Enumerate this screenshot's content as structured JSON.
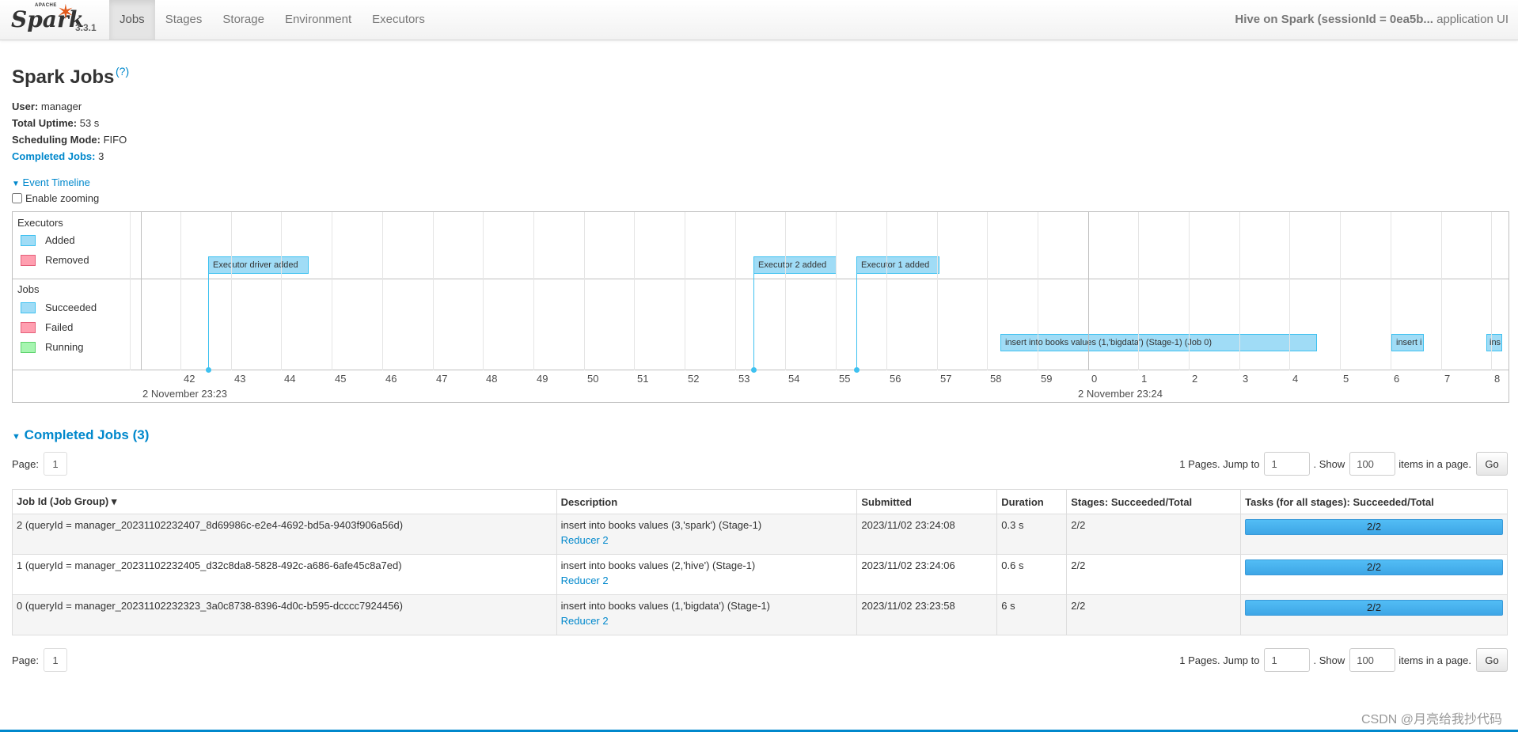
{
  "navbar": {
    "brand_apache": "APACHE",
    "brand_spark": "Spark",
    "version": "3.3.1",
    "tabs": [
      {
        "label": "Jobs",
        "active": true
      },
      {
        "label": "Stages",
        "active": false
      },
      {
        "label": "Storage",
        "active": false
      },
      {
        "label": "Environment",
        "active": false
      },
      {
        "label": "Executors",
        "active": false
      }
    ],
    "app_name_bold": "Hive on Spark (sessionId = 0ea5b...",
    "app_name_suffix": " application UI"
  },
  "page": {
    "title": "Spark Jobs",
    "help": "(?)"
  },
  "summary": {
    "user_label": "User:",
    "user": "manager",
    "uptime_label": "Total Uptime:",
    "uptime": "53 s",
    "mode_label": "Scheduling Mode:",
    "mode": "FIFO",
    "completed_label": "Completed Jobs:",
    "completed": "3"
  },
  "timeline": {
    "toggle": "Event Timeline",
    "zoom_label": "Enable zooming",
    "executors_label": "Executors",
    "jobs_label": "Jobs",
    "legend_exec": [
      {
        "label": "Added",
        "color": "#a0dcf6"
      },
      {
        "label": "Removed",
        "color": "#ff9fb0"
      }
    ],
    "legend_jobs": [
      {
        "label": "Succeeded",
        "color": "#a0dcf6"
      },
      {
        "label": "Failed",
        "color": "#ff9fb0"
      },
      {
        "label": "Running",
        "color": "#a6f5b0"
      }
    ],
    "executor_events": [
      "Executor driver added",
      "Executor 2 added",
      "Executor 1 added"
    ],
    "job_events": [
      "insert into books values (1,'bigdata') (Stage-1) (Job 0)",
      "insert i",
      "ins"
    ],
    "ticks": [
      "42",
      "43",
      "44",
      "45",
      "46",
      "47",
      "48",
      "49",
      "50",
      "51",
      "52",
      "53",
      "54",
      "55",
      "56",
      "57",
      "58",
      "59",
      "0",
      "1",
      "2",
      "3",
      "4",
      "5",
      "6",
      "7",
      "8"
    ],
    "day_left": "2 November 23:23",
    "day_right": "2 November 23:24"
  },
  "completed": {
    "title": "Completed Jobs (3)",
    "page_label": "Page:",
    "page_num": "1",
    "pages_text": "1 Pages. Jump to",
    "jump_value": "1",
    "show_text": ". Show",
    "show_value": "100",
    "items_text": "items in a page.",
    "go": "Go"
  },
  "table": {
    "headers": [
      "Job Id (Job Group) ▾",
      "Description",
      "Submitted",
      "Duration",
      "Stages: Succeeded/Total",
      "Tasks (for all stages): Succeeded/Total"
    ],
    "rows": [
      {
        "id": "2 (queryId = manager_20231102232407_8d69986c-e2e4-4692-bd5a-9403f906a56d)",
        "desc": "insert into books values (3,'spark') (Stage-1)",
        "link": "Reducer 2",
        "submitted": "2023/11/02 23:24:08",
        "duration": "0.3 s",
        "stages": "2/2",
        "tasks": "2/2"
      },
      {
        "id": "1 (queryId = manager_20231102232405_d32c8da8-5828-492c-a686-6afe45c8a7ed)",
        "desc": "insert into books values (2,'hive') (Stage-1)",
        "link": "Reducer 2",
        "submitted": "2023/11/02 23:24:06",
        "duration": "0.6 s",
        "stages": "2/2",
        "tasks": "2/2"
      },
      {
        "id": "0 (queryId = manager_20231102232323_3a0c8738-8396-4d0c-b595-dcccc7924456)",
        "desc": "insert into books values (1,'bigdata') (Stage-1)",
        "link": "Reducer 2",
        "submitted": "2023/11/02 23:23:58",
        "duration": "6 s",
        "stages": "2/2",
        "tasks": "2/2"
      }
    ]
  },
  "watermark": "CSDN @月亮给我抄代码"
}
